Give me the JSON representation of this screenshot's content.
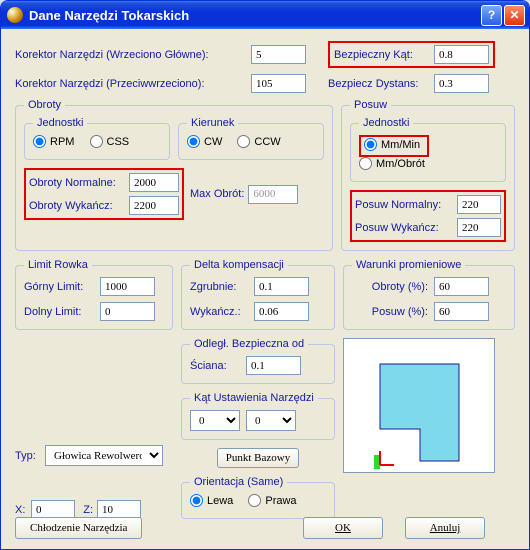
{
  "title": "Dane Narzędzi Tokarskich",
  "korektor_glowne": {
    "label": "Korektor Narzędzi (Wrzeciono Główne):",
    "value": "5"
  },
  "korektor_przeciw": {
    "label": "Korektor Narzędzi (Przeciwwrzeciono):",
    "value": "105"
  },
  "bezp_kat": {
    "label": "Bezpieczny Kąt:",
    "value": "0.8"
  },
  "bezp_dystans": {
    "label": "Bezpiecz Dystans:",
    "value": "0.3"
  },
  "obroty": {
    "legend": "Obroty",
    "jednostki": {
      "legend": "Jednostki",
      "rpm": "RPM",
      "css": "CSS"
    },
    "kierunek": {
      "legend": "Kierunek",
      "cw": "CW",
      "ccw": "CCW"
    },
    "normalne": {
      "label": "Obroty Normalne:",
      "value": "2000"
    },
    "wykancz": {
      "label": "Obroty Wykańcz:",
      "value": "2200"
    },
    "max": {
      "label": "Max Obrót:",
      "value": "6000"
    }
  },
  "posuw": {
    "legend": "Posuw",
    "jednostki": {
      "legend": "Jednostki",
      "mmmin": "Mm/Min",
      "mmobrot": "Mm/Obrót"
    },
    "normalny": {
      "label": "Posuw Normalny:",
      "value": "220"
    },
    "wykancz": {
      "label": "Posuw Wykańcz:",
      "value": "220"
    }
  },
  "limit_rowka": {
    "legend": "Limit Rowka",
    "gorny": {
      "label": "Górny Limit:",
      "value": "1000"
    },
    "dolny": {
      "label": "Dolny Limit:",
      "value": "0"
    }
  },
  "delta": {
    "legend": "Delta kompensacji",
    "zgrubnie": {
      "label": "Zgrubnie:",
      "value": "0.1"
    },
    "wykancz": {
      "label": "Wykańcz.:",
      "value": "0.06"
    }
  },
  "warunki": {
    "legend": "Warunki promieniowe",
    "obroty": {
      "label": "Obroty (%):",
      "value": "60"
    },
    "posuw": {
      "label": "Posuw (%):",
      "value": "60"
    }
  },
  "odlegl": {
    "legend": "Odległ. Bezpieczna od",
    "sciana": {
      "label": "Ściana:",
      "value": "0.1"
    }
  },
  "kat_ust": {
    "legend": "Kąt Ustawienia Narzędzi",
    "val1": "0",
    "val2": "0",
    "punkt_bazowy": "Punkt Bazowy"
  },
  "typ": {
    "label": "Typ:",
    "value": "Głowica Rewolwero"
  },
  "x": {
    "label": "X:",
    "value": "0"
  },
  "z": {
    "label": "Z:",
    "value": "10"
  },
  "orientacja": {
    "legend": "Orientacja (Same)",
    "lewa": "Lewa",
    "prawa": "Prawa"
  },
  "buttons": {
    "chlodzenie": "Chłodzenie Narzędzia",
    "ok": "OK",
    "anuluj": "Anuluj"
  }
}
